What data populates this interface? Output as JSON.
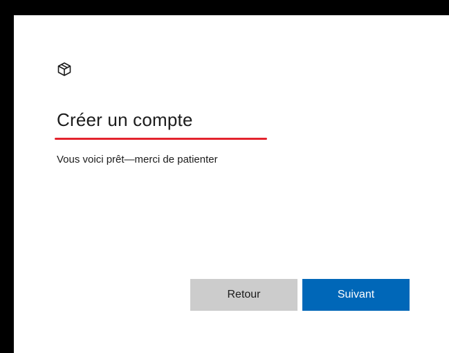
{
  "dialog": {
    "icon": "package-box-icon",
    "title": "Créer un compte",
    "subtitle": "Vous voici prêt—merci de patienter",
    "accent_underline_color": "#e3232d"
  },
  "buttons": {
    "back_label": "Retour",
    "next_label": "Suivant",
    "back_color": "#cccccc",
    "next_color": "#0067b8"
  }
}
